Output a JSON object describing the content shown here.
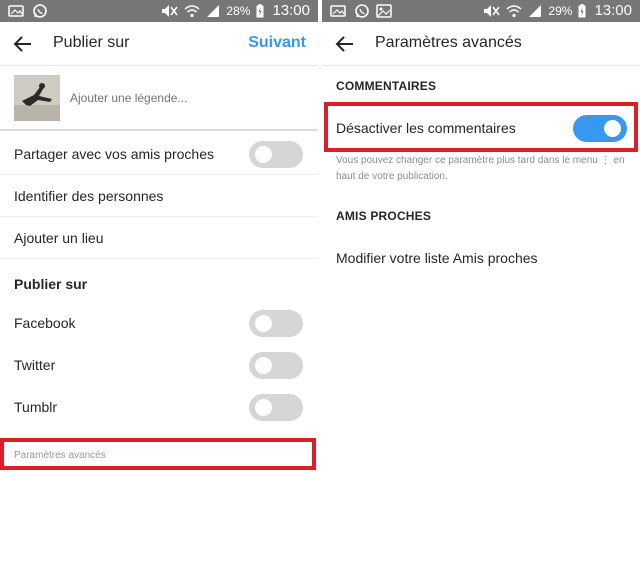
{
  "left": {
    "statusbar": {
      "battery": "28%",
      "time": "13:00"
    },
    "header": {
      "title": "Publier sur",
      "next": "Suivant"
    },
    "caption": {
      "placeholder": "Ajouter une légende..."
    },
    "rows": {
      "close_friends": {
        "label": "Partager avec vos amis proches",
        "on": false
      },
      "tag_people": {
        "label": "Identifier des personnes"
      },
      "add_location": {
        "label": "Ajouter un lieu"
      }
    },
    "publish_section": "Publier sur",
    "networks": [
      {
        "label": "Facebook",
        "on": false
      },
      {
        "label": "Twitter",
        "on": false
      },
      {
        "label": "Tumblr",
        "on": false
      }
    ],
    "advanced": "Paramètres avancés"
  },
  "right": {
    "statusbar": {
      "battery": "29%",
      "time": "13:00"
    },
    "header": {
      "title": "Paramètres avancés"
    },
    "comments_section": "COMMENTAIRES",
    "disable_comments": {
      "label": "Désactiver les commentaires",
      "on": true
    },
    "helper": "Vous pouvez changer ce paramètre plus tard dans le menu ⋮ en haut de votre publication.",
    "close_friends_section": "AMIS PROCHES",
    "edit_close_friends": "Modifier votre liste Amis proches"
  },
  "colors": {
    "accent": "#3897f0",
    "highlight": "#d9202a",
    "statusbar": "#777777"
  }
}
